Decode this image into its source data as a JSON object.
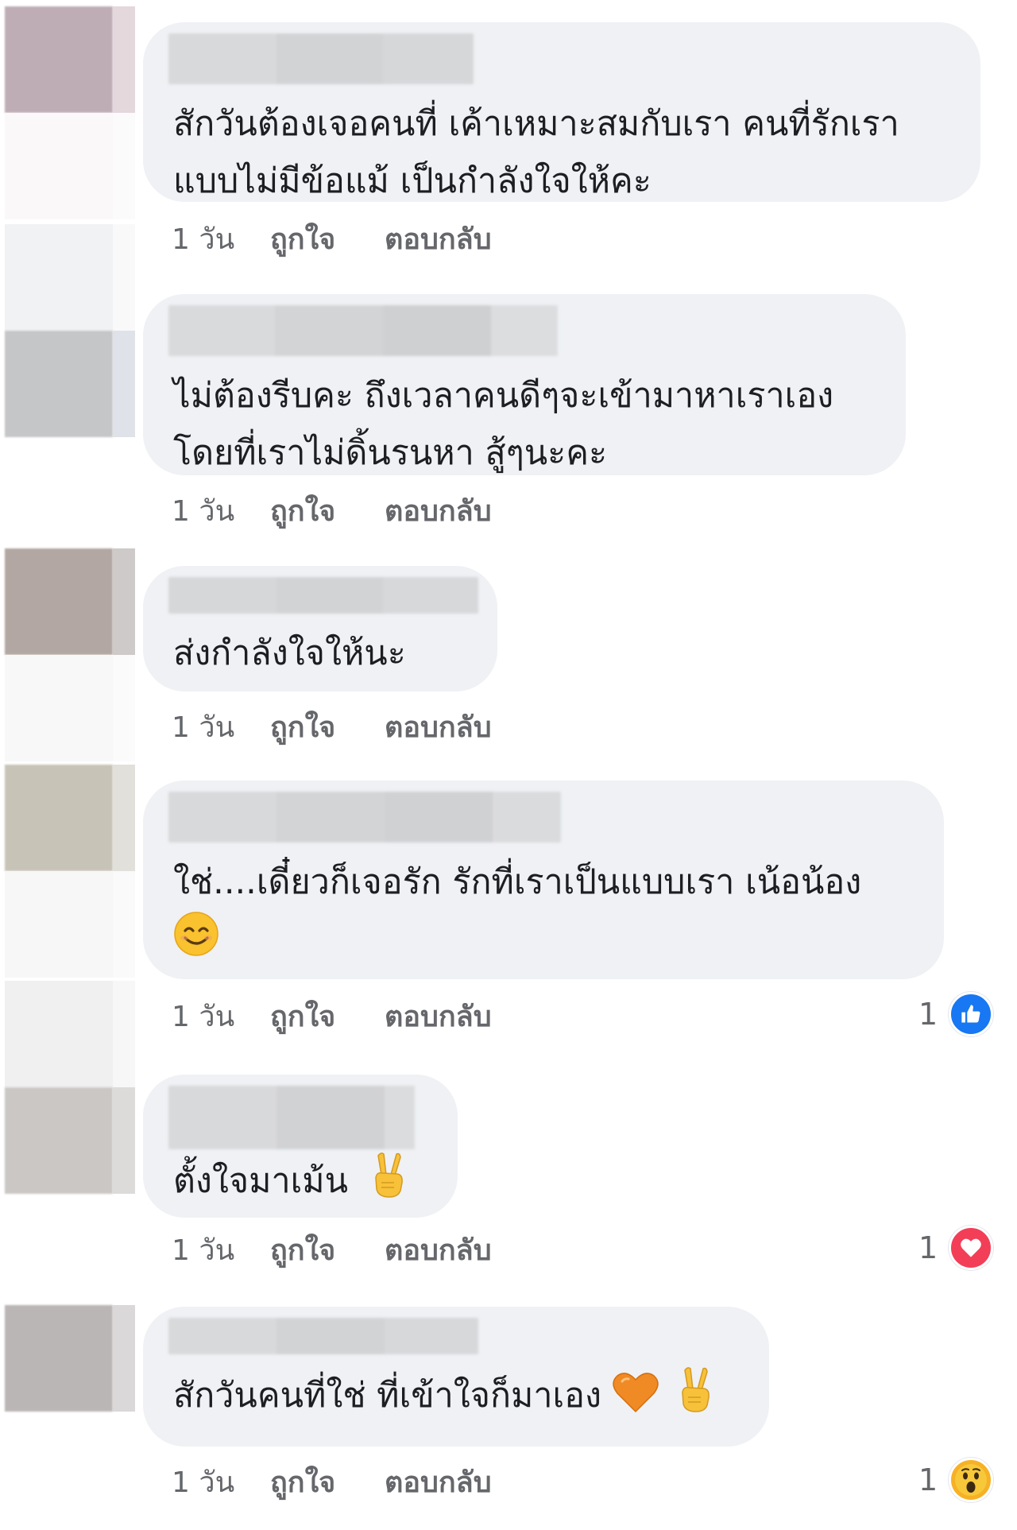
{
  "colors": {
    "bubble_bg": "#eff1f4",
    "text": "#1c1e21",
    "meta": "#65676b",
    "like_blue": "#1877f2",
    "love_red": "#f33e58",
    "wow_yellow": "#f7b125"
  },
  "comments": [
    {
      "text_lines": [
        "สักวันต้องเจอคนที่ เค้าเหมาะสมกับเรา คนที่รักเรา",
        "แบบไม่มีข้อแม้ เป็นกำลังใจให้คะ"
      ],
      "time": "1 วัน",
      "like_label": "ถูกใจ",
      "reply_label": "ตอบกลับ"
    },
    {
      "text_lines": [
        "ไม่ต้องรีบคะ ถึงเวลาคนดีๆจะเข้ามาหาเราเอง",
        "โดยที่เราไม่ดิ้นรนหา สู้ๆนะคะ"
      ],
      "time": "1 วัน",
      "like_label": "ถูกใจ",
      "reply_label": "ตอบกลับ"
    },
    {
      "text_lines": [
        "ส่งกำลังใจให้นะ"
      ],
      "time": "1 วัน",
      "like_label": "ถูกใจ",
      "reply_label": "ตอบกลับ"
    },
    {
      "text_lines": [
        "ใช่....เดี๋ยวก็เจอรัก รักที่เราเป็นแบบเรา เน้อน้อง"
      ],
      "emoji_line": "smiling-face-emoji",
      "time": "1 วัน",
      "like_label": "ถูกใจ",
      "reply_label": "ตอบกลับ",
      "reaction": {
        "count": "1",
        "icon": "like-icon"
      }
    },
    {
      "text_lines": [
        "ตั้งใจมาเม้น"
      ],
      "trailing_emoji": [
        "victory-hand-emoji"
      ],
      "time": "1 วัน",
      "like_label": "ถูกใจ",
      "reply_label": "ตอบกลับ",
      "reaction": {
        "count": "1",
        "icon": "love-icon"
      }
    },
    {
      "text_lines": [
        "สักวันคนที่ใช่ ที่เข้าใจก็มาเอง"
      ],
      "trailing_emoji": [
        "orange-heart-emoji",
        "victory-hand-emoji"
      ],
      "time": "1 วัน",
      "like_label": "ถูกใจ",
      "reply_label": "ตอบกลับ",
      "reaction": {
        "count": "1",
        "icon": "wow-icon"
      }
    }
  ]
}
